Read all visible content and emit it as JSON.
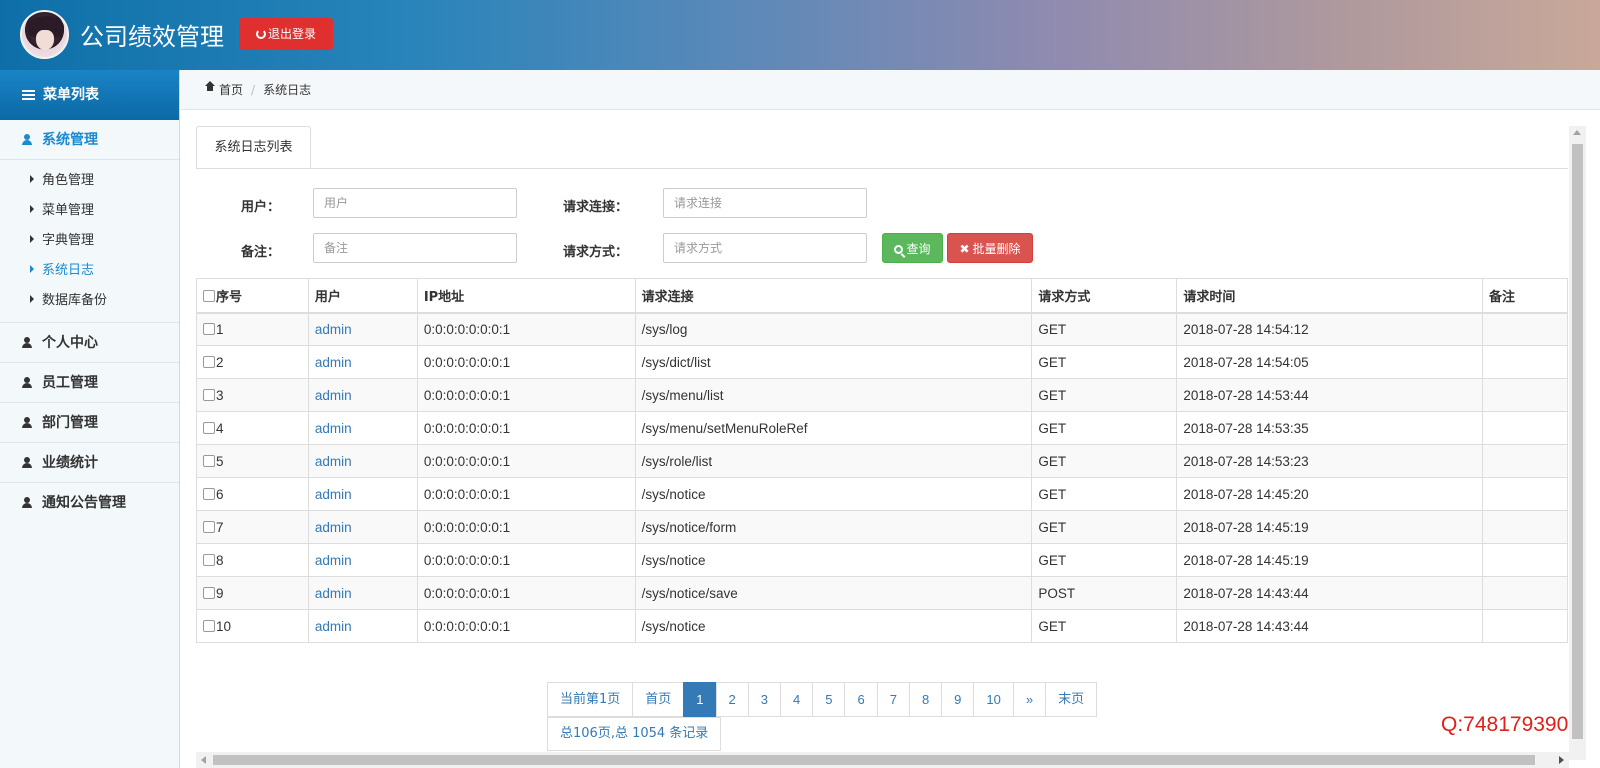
{
  "header": {
    "title": "公司绩效管理",
    "logout_label": "退出登录"
  },
  "sidebar": {
    "heading": "菜单列表",
    "groups": [
      {
        "label": "系统管理",
        "active": true
      },
      {
        "label": "个人中心"
      },
      {
        "label": "员工管理"
      },
      {
        "label": "部门管理"
      },
      {
        "label": "业绩统计"
      },
      {
        "label": "通知公告管理"
      }
    ],
    "subitems": [
      {
        "label": "角色管理"
      },
      {
        "label": "菜单管理"
      },
      {
        "label": "字典管理"
      },
      {
        "label": "系统日志",
        "active": true
      },
      {
        "label": "数据库备份"
      }
    ]
  },
  "breadcrumb": {
    "home": "首页",
    "current": "系统日志"
  },
  "tab": {
    "label": "系统日志列表"
  },
  "filters": {
    "user_label": "用户：",
    "user_placeholder": "用户",
    "url_label": "请求连接：",
    "url_placeholder": "请求连接",
    "remark_label": "备注：",
    "remark_placeholder": "备注",
    "method_label": "请求方式：",
    "method_placeholder": "请求方式",
    "query_label": "查询",
    "batch_delete_label": "批量删除"
  },
  "table": {
    "columns": [
      "序号",
      "用户",
      "IP地址",
      "请求连接",
      "请求方式",
      "请求时间",
      "备注"
    ],
    "rows": [
      {
        "no": "1",
        "user": "admin",
        "ip": "0:0:0:0:0:0:0:1",
        "url": "/sys/log",
        "method": "GET",
        "time": "2018-07-28 14:54:12",
        "remark": ""
      },
      {
        "no": "2",
        "user": "admin",
        "ip": "0:0:0:0:0:0:0:1",
        "url": "/sys/dict/list",
        "method": "GET",
        "time": "2018-07-28 14:54:05",
        "remark": ""
      },
      {
        "no": "3",
        "user": "admin",
        "ip": "0:0:0:0:0:0:0:1",
        "url": "/sys/menu/list",
        "method": "GET",
        "time": "2018-07-28 14:53:44",
        "remark": ""
      },
      {
        "no": "4",
        "user": "admin",
        "ip": "0:0:0:0:0:0:0:1",
        "url": "/sys/menu/setMenuRoleRef",
        "method": "GET",
        "time": "2018-07-28 14:53:35",
        "remark": ""
      },
      {
        "no": "5",
        "user": "admin",
        "ip": "0:0:0:0:0:0:0:1",
        "url": "/sys/role/list",
        "method": "GET",
        "time": "2018-07-28 14:53:23",
        "remark": ""
      },
      {
        "no": "6",
        "user": "admin",
        "ip": "0:0:0:0:0:0:0:1",
        "url": "/sys/notice",
        "method": "GET",
        "time": "2018-07-28 14:45:20",
        "remark": ""
      },
      {
        "no": "7",
        "user": "admin",
        "ip": "0:0:0:0:0:0:0:1",
        "url": "/sys/notice/form",
        "method": "GET",
        "time": "2018-07-28 14:45:19",
        "remark": ""
      },
      {
        "no": "8",
        "user": "admin",
        "ip": "0:0:0:0:0:0:0:1",
        "url": "/sys/notice",
        "method": "GET",
        "time": "2018-07-28 14:45:19",
        "remark": ""
      },
      {
        "no": "9",
        "user": "admin",
        "ip": "0:0:0:0:0:0:0:1",
        "url": "/sys/notice/save",
        "method": "POST",
        "time": "2018-07-28 14:43:44",
        "remark": ""
      },
      {
        "no": "10",
        "user": "admin",
        "ip": "0:0:0:0:0:0:0:1",
        "url": "/sys/notice",
        "method": "GET",
        "time": "2018-07-28 14:43:44",
        "remark": ""
      }
    ]
  },
  "pagination": {
    "current_label": "当前第1页",
    "first_label": "首页",
    "pages": [
      "1",
      "2",
      "3",
      "4",
      "5",
      "6",
      "7",
      "8",
      "9",
      "10"
    ],
    "next_label": "»",
    "last_label": "末页",
    "total_label": "总106页,总 1054 条记录"
  },
  "watermark": "Q:748179390",
  "colors": {
    "accent": "#1b8bd1",
    "logout": "#e02f2f",
    "query": "#5cb85c",
    "delete": "#d9534f",
    "link": "#337ab7",
    "watermark": "#e0201b"
  },
  "icons": {
    "logout": "power-icon",
    "menu": "list-icon",
    "group": "user-icon",
    "subitem": "caret-right-icon",
    "home": "home-icon",
    "query": "search-icon",
    "delete": "times-icon"
  }
}
